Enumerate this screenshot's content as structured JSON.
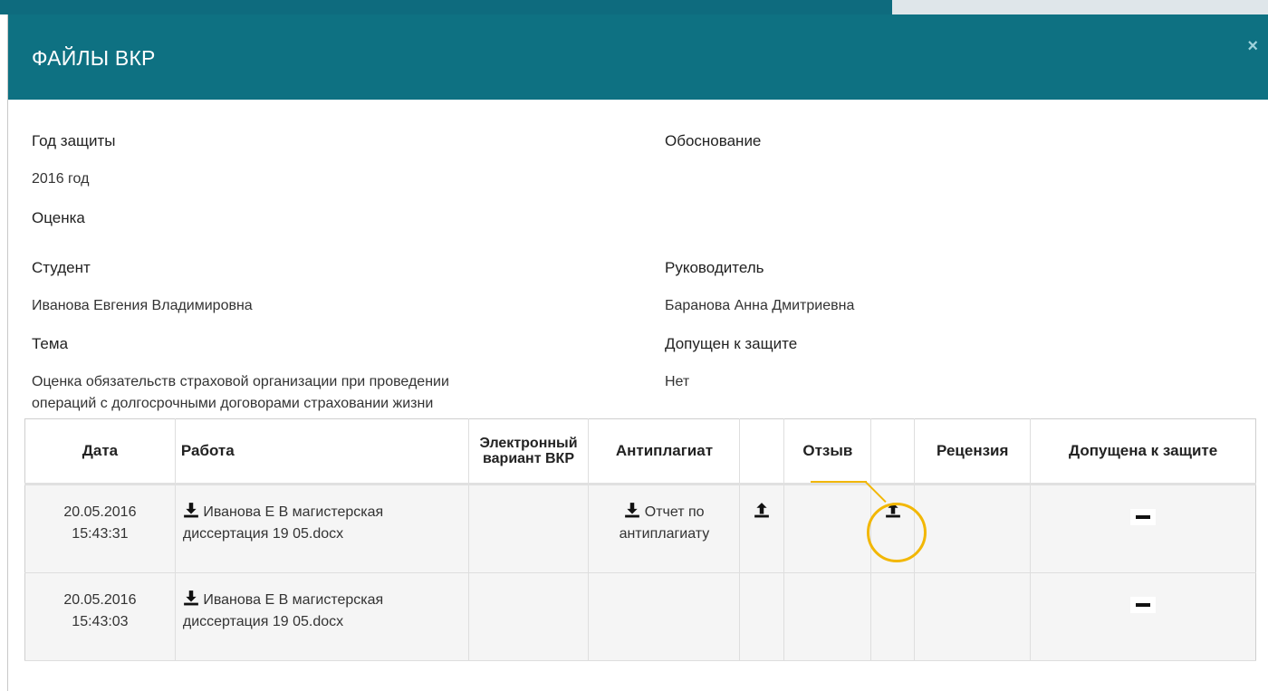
{
  "modal": {
    "title": "ФАЙЛЫ ВКР",
    "close_label": "×"
  },
  "fields": {
    "year_label": "Год защиты",
    "year_value": "2016 год",
    "grade_label": "Оценка",
    "grade_value": "",
    "basis_label": "Обоснование",
    "student_label": "Студент",
    "student_value": "Иванова Евгения Владимировна",
    "supervisor_label": "Руководитель",
    "supervisor_value": "Баранова Анна Дмитриевна",
    "topic_label": "Тема",
    "topic_value_line1": "Оценка обязательств страховой организации при проведении",
    "topic_value_line2": "операций с долгосрочными договорами страховании жизни",
    "admitted_label": "Допущен к защите",
    "admitted_value": "Нет"
  },
  "table": {
    "headers": {
      "date": "Дата",
      "work": "Работа",
      "electronic_line1": "Электронный",
      "electronic_line2": "вариант ВКР",
      "antiplagiarism": "Антиплагиат",
      "review": "Отзыв",
      "referee": "Рецензия",
      "admitted": "Допущена к защите"
    },
    "rows": [
      {
        "date": "20.05.2016",
        "time": "15:43:31",
        "work_line1": "Иванова Е В магистерская",
        "work_line2": "диссертация 19 05.docx",
        "report_line1": "Отчет по",
        "report_line2": "антиплагиату"
      },
      {
        "date": "20.05.2016",
        "time": "15:43:03",
        "work_line1": "Иванова Е В магистерская",
        "work_line2": "диссертация 19 05.docx"
      }
    ]
  },
  "icons": {
    "download": "download-icon",
    "upload": "upload-icon",
    "minus": "minus-icon"
  },
  "colors": {
    "header_bg": "#0e7182",
    "highlight": "#f2b705"
  }
}
